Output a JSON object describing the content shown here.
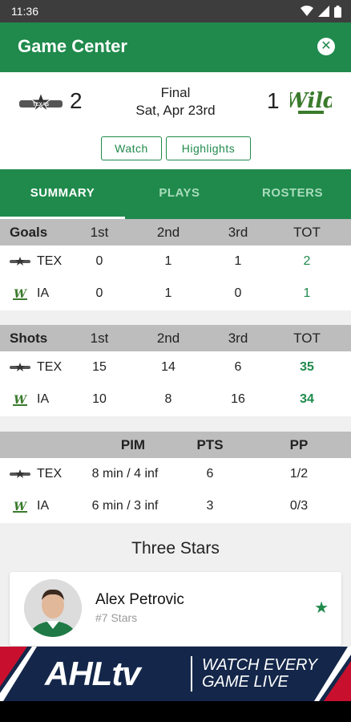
{
  "status_bar": {
    "time": "11:36"
  },
  "app_bar": {
    "title": "Game Center",
    "close_icon": "close-icon"
  },
  "game": {
    "away": {
      "abbr": "TEX",
      "score": "2",
      "logo_text": "TEXAS"
    },
    "home": {
      "abbr": "IA",
      "score": "1",
      "logo_text": "Wild"
    },
    "status": "Final",
    "date": "Sat, Apr 23rd",
    "buttons": {
      "watch": "Watch",
      "highlights": "Highlights"
    }
  },
  "tabs": [
    {
      "label": "SUMMARY",
      "active": true
    },
    {
      "label": "PLAYS",
      "active": false
    },
    {
      "label": "ROSTERS",
      "active": false
    }
  ],
  "goals": {
    "header": [
      "Goals",
      "1st",
      "2nd",
      "3rd",
      "TOT"
    ],
    "rows": [
      {
        "team": "TEX",
        "values": [
          "0",
          "1",
          "1",
          "2"
        ]
      },
      {
        "team": "IA",
        "values": [
          "0",
          "1",
          "0",
          "1"
        ]
      }
    ]
  },
  "shots": {
    "header": [
      "Shots",
      "1st",
      "2nd",
      "3rd",
      "TOT"
    ],
    "rows": [
      {
        "team": "TEX",
        "values": [
          "15",
          "14",
          "6",
          "35"
        ]
      },
      {
        "team": "IA",
        "values": [
          "10",
          "8",
          "16",
          "34"
        ]
      }
    ]
  },
  "special": {
    "header": [
      "",
      "PIM",
      "PTS",
      "PP"
    ],
    "rows": [
      {
        "team": "TEX",
        "values": [
          "8 min / 4 inf",
          "6",
          "1/2"
        ]
      },
      {
        "team": "IA",
        "values": [
          "6 min / 3 inf",
          "3",
          "0/3"
        ]
      }
    ]
  },
  "three_stars": {
    "title": "Three Stars",
    "stars": [
      {
        "name": "Alex Petrovic",
        "subtitle": "#7 Stars"
      }
    ]
  },
  "banner": {
    "wordmark": "AHLtv",
    "tagline_1": "WATCH EVERY",
    "tagline_2": "GAME LIVE"
  },
  "colors": {
    "primary": "#1f8a4c",
    "header_gray": "#bdbdbd",
    "banner_navy": "#14274a"
  }
}
